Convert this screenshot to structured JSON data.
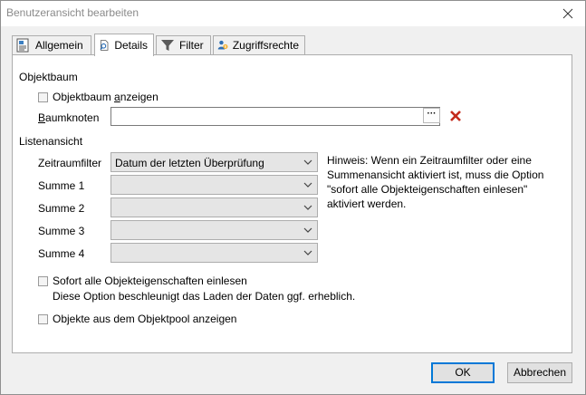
{
  "window": {
    "title": "Benutzeransicht bearbeiten"
  },
  "tabs": [
    {
      "label": "Allgemein",
      "icon": "general-settings-icon"
    },
    {
      "label": "Details",
      "icon": "document-search-icon",
      "active": true
    },
    {
      "label": "Filter",
      "icon": "funnel-filter-icon"
    },
    {
      "label": "Zugriffsrechte",
      "icon": "users-access-icon"
    }
  ],
  "objektbaum": {
    "group_label": "Objektbaum",
    "show_tree_checkbox": {
      "label_prefix": "Objektbaum ",
      "label_accel": "a",
      "label_suffix": "nzeigen",
      "checked": false
    },
    "baumknoten": {
      "label_accel": "B",
      "label_rest": "aumknoten",
      "value": "",
      "browse_label": "···"
    }
  },
  "listenansicht": {
    "group_label": "Listenansicht",
    "rows": [
      {
        "label": "Zeitraumfilter",
        "value": "Datum der letzten Überprüfung"
      },
      {
        "label": "Summe 1",
        "value": ""
      },
      {
        "label": "Summe 2",
        "value": ""
      },
      {
        "label": "Summe 3",
        "value": ""
      },
      {
        "label": "Summe 4",
        "value": ""
      }
    ],
    "hint": "Hinweis: Wenn ein Zeitraumfilter oder eine Summenansicht aktiviert ist, muss die Option \"sofort alle Objekteigenschaften einlesen\" aktiviert werden."
  },
  "options": {
    "read_all": {
      "label": "Sofort alle Objekteigenschaften einlesen",
      "description": "Diese Option beschleunigt das Laden der Daten ggf. erheblich.",
      "checked": false
    },
    "pool": {
      "label": "Objekte aus dem Objektpool anzeigen",
      "checked": false
    }
  },
  "buttons": {
    "ok": "OK",
    "cancel": "Abbrechen"
  },
  "colors": {
    "accent": "#0078d7",
    "remove": "#c42b1c"
  }
}
